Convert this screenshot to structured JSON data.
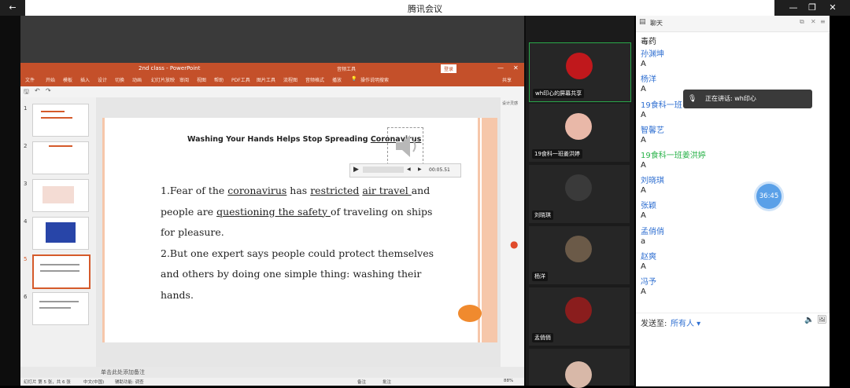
{
  "window": {
    "title": "腾讯会议",
    "back_icon": "←",
    "min_icon": "—",
    "max_icon": "❐",
    "close_icon": "✕"
  },
  "ppt": {
    "title": "2nd class  -  PowerPoint",
    "context_tab": "音频工具",
    "login": "登录",
    "ribbon": [
      "文件",
      "开始",
      "模板",
      "插入",
      "设计",
      "切换",
      "动画",
      "幻灯片放映",
      "审阅",
      "视图",
      "帮助",
      "PDF工具",
      "图片工具",
      "流程图",
      "音频格式",
      "播放",
      "操作说明搜索"
    ],
    "share": "共享",
    "slide_title": "Washing Your Hands Helps Stop Spreading",
    "slide_title_ul": "Coronavirus",
    "player_time": "00:05.51",
    "body": {
      "p1_a": "1.Fear of the ",
      "p1_u1": "coronavirus",
      "p1_b": " has ",
      "p1_u2": "restricted",
      "p1_c": " ",
      "p1_u3": "air travel ",
      "p1_d": "and people are ",
      "p1_u4": "questioning the safety ",
      "p1_e": "of traveling on ships for pleasure.",
      "p2": "2.But one expert says people could protect themselves and others by doing one simple thing: washing their hands."
    },
    "thumb_numbers": [
      "1",
      "2",
      "3",
      "4",
      "5",
      "6"
    ],
    "notes": "单击此处添加备注",
    "status_left": "幻灯片 第 5 张，共 6 张",
    "status_lang": "中文(中国)",
    "status_a11y": "辅助功能: 调查",
    "status_notes": "备注",
    "status_comments": "批注",
    "status_zoom": "88%",
    "right_panel_label": "设计灵感"
  },
  "participants": [
    {
      "name": "wh印心的屏幕共享",
      "avatar_color": "#c0181c"
    },
    {
      "name": "19食科一班姜洪婷",
      "avatar_color": "#e9b8a8"
    },
    {
      "name": "刘晓琪",
      "avatar_color": "#3a3a3a"
    },
    {
      "name": "杨洋",
      "avatar_color": "#6b5a48"
    },
    {
      "name": "孟俏俏",
      "avatar_color": "#8a1d1d"
    },
    {
      "name": "",
      "avatar_color": "#d8b8a8"
    }
  ],
  "chat": {
    "header": "聊天",
    "messages": [
      {
        "text": "毒药",
        "type": "msg"
      },
      {
        "text": "孙渊坤",
        "type": "name"
      },
      {
        "text": "A",
        "type": "msg"
      },
      {
        "text": "杨洋",
        "type": "name"
      },
      {
        "text": "A",
        "type": "msg"
      },
      {
        "text": "19食科一班",
        "type": "name"
      },
      {
        "text": "A",
        "type": "msg"
      },
      {
        "text": "智馨艺",
        "type": "name"
      },
      {
        "text": "A",
        "type": "msg"
      },
      {
        "text": "19食科一班姜洪婷",
        "type": "name-green"
      },
      {
        "text": "A",
        "type": "msg"
      },
      {
        "text": "刘晓琪",
        "type": "name"
      },
      {
        "text": "A",
        "type": "msg"
      },
      {
        "text": "张颖",
        "type": "name"
      },
      {
        "text": "A",
        "type": "msg"
      },
      {
        "text": "孟俏俏",
        "type": "name"
      },
      {
        "text": "a",
        "type": "msg"
      },
      {
        "text": "赵爽",
        "type": "name"
      },
      {
        "text": "A",
        "type": "msg"
      },
      {
        "text": "冯予",
        "type": "name"
      },
      {
        "text": "A",
        "type": "msg"
      }
    ],
    "send_to_label": "发送至:",
    "send_to_value": "所有人 ▾"
  },
  "speaking": "正在讲话: wh印心",
  "timer": "36:45"
}
